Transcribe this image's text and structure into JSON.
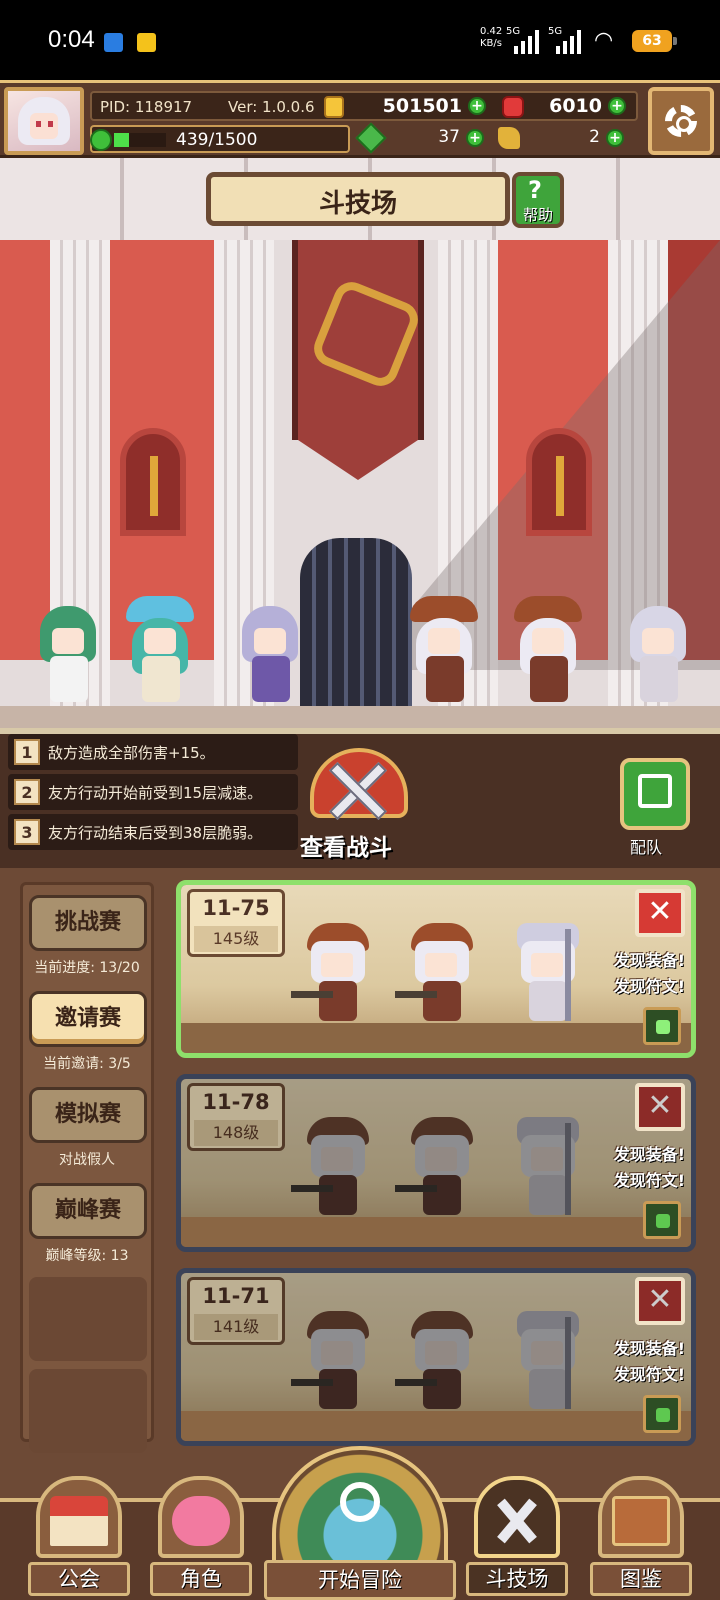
{
  "status_bar": {
    "time": "0:04",
    "net_speed_value": "0.42",
    "net_speed_unit": "KB/s",
    "signal1_label": "5G",
    "signal2_label": "5G",
    "battery": "63",
    "icons": [
      "app-notification-icon",
      "app-notification-icon-2",
      "signal-icon",
      "wifi-icon",
      "battery-icon"
    ]
  },
  "hud": {
    "pid": "PID: 118917",
    "version": "Ver: 1.0.0.6",
    "gold": "501501",
    "gems": "6010",
    "energy_text": "439/1500",
    "energy_fraction": 0.29,
    "stamina": "37",
    "keys": "2"
  },
  "arena": {
    "title": "斗技场",
    "help_label": "帮助"
  },
  "buffs": [
    {
      "num": "1",
      "text": "敌方造成全部伤害+15。"
    },
    {
      "num": "2",
      "text": "友方行动开始前受到15层减速。"
    },
    {
      "num": "3",
      "text": "友方行动结束后受到38层脆弱。"
    }
  ],
  "view_battle_label": "查看战斗",
  "team_label": "配队",
  "modes": [
    {
      "label": "挑战赛",
      "sub": "当前进度: 13/20",
      "active": false
    },
    {
      "label": "邀请赛",
      "sub": "当前邀请: 3/5",
      "active": true
    },
    {
      "label": "模拟赛",
      "sub": "对战假人",
      "active": false
    },
    {
      "label": "巅峰赛",
      "sub": "巅峰等级: 13",
      "active": false
    }
  ],
  "opponents": [
    {
      "stage": "11-75",
      "level": "145级",
      "find_equip": "发现装备!",
      "find_rune": "发现符文!",
      "selected": true,
      "close": "✕"
    },
    {
      "stage": "11-78",
      "level": "148级",
      "find_equip": "发现装备!",
      "find_rune": "发现符文!",
      "selected": false,
      "close": "✕"
    },
    {
      "stage": "11-71",
      "level": "141级",
      "find_equip": "发现装备!",
      "find_rune": "发现符文!",
      "selected": false,
      "close": "✕"
    }
  ],
  "nav": {
    "guild": "公会",
    "role": "角色",
    "start": "开始冒险",
    "arena": "斗技场",
    "codex": "图鉴",
    "active": "arena"
  },
  "colors": {
    "hud_bg": "#5a3a2a",
    "accent_gold": "#e8c27a",
    "selected_card_border": "#8ee06b",
    "close_red": "#d63a34",
    "plus_green": "#3fbf3a"
  }
}
